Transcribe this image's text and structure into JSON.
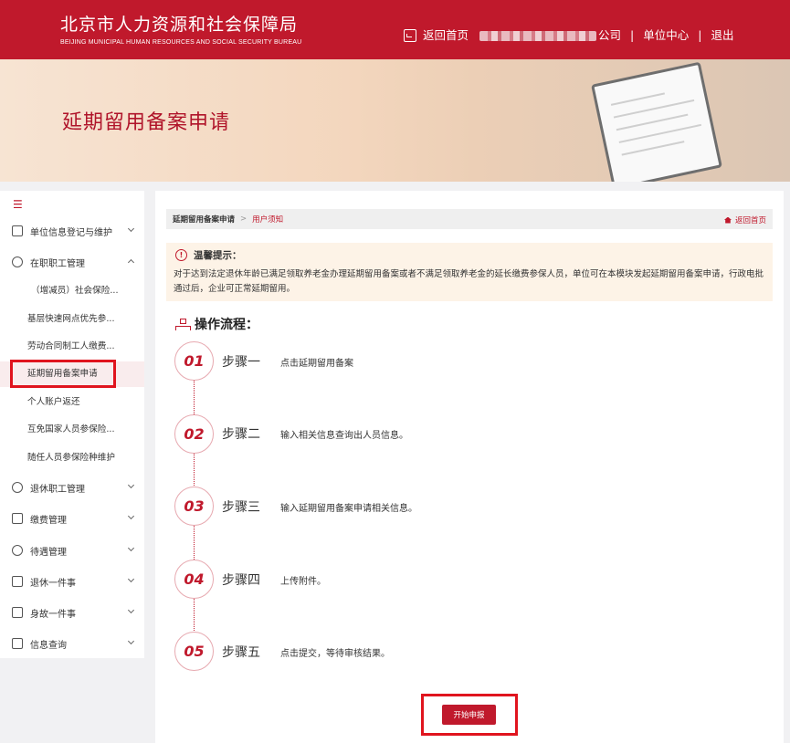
{
  "header": {
    "title_cn": "北京市人力资源和社会保障局",
    "title_en": "BEIJING MUNICIPAL HUMAN RESOURCES AND SOCIAL SECURITY BUREAU",
    "nav": {
      "home": "返回首页",
      "company_suffix": "公司",
      "separator": "|",
      "unit_center": "单位中心",
      "logout": "退出"
    },
    "brand_color": "#c0192c"
  },
  "banner": {
    "title": "延期留用备案申请"
  },
  "sidebar": {
    "items": [
      {
        "label": "单位信息登记与维护",
        "icon": "building-icon",
        "expanded": false
      },
      {
        "label": "在职职工管理",
        "icon": "person-icon",
        "expanded": true
      },
      {
        "label": "退休职工管理",
        "icon": "person-icon",
        "expanded": false
      },
      {
        "label": "缴费管理",
        "icon": "wallet-icon",
        "expanded": false
      },
      {
        "label": "待遇管理",
        "icon": "benefit-icon",
        "expanded": false
      },
      {
        "label": "退休一件事",
        "icon": "retire-icon",
        "expanded": false
      },
      {
        "label": "身故一件事",
        "icon": "card-icon",
        "expanded": false
      },
      {
        "label": "信息查询",
        "icon": "search-doc-icon",
        "expanded": false
      }
    ],
    "subitems": [
      "（增减员）社会保险...",
      "基层快速网点优先参...",
      "劳动合同制工人缴费...",
      "延期留用备案申请",
      "个人账户返还",
      "互免国家人员参保险...",
      "随任人员参保险种维护"
    ],
    "active_subitem": "延期留用备案申请"
  },
  "breadcrumb": {
    "level1": "延期留用备案申请",
    "separator": ">",
    "level2": "用户须知",
    "home_link": "返回首页"
  },
  "notice": {
    "title": "温馨提示：",
    "body": "对于达到法定退休年龄已满足领取养老金办理延期留用备案或者不满足领取养老金的延长缴费参保人员，单位可在本模块发起延期留用备案申请，行政电批通过后，企业可正常延期留用。"
  },
  "flow": {
    "title": "操作流程：",
    "steps": [
      {
        "num": "01",
        "name": "步骤一",
        "desc": "点击延期留用备案"
      },
      {
        "num": "02",
        "name": "步骤二",
        "desc": "输入相关信息查询出人员信息。"
      },
      {
        "num": "03",
        "name": "步骤三",
        "desc": "输入延期留用备案申请相关信息。"
      },
      {
        "num": "04",
        "name": "步骤四",
        "desc": "上传附件。"
      },
      {
        "num": "05",
        "name": "步骤五",
        "desc": "点击提交，等待审核结果。"
      }
    ]
  },
  "actions": {
    "start_label": "开始申报"
  }
}
